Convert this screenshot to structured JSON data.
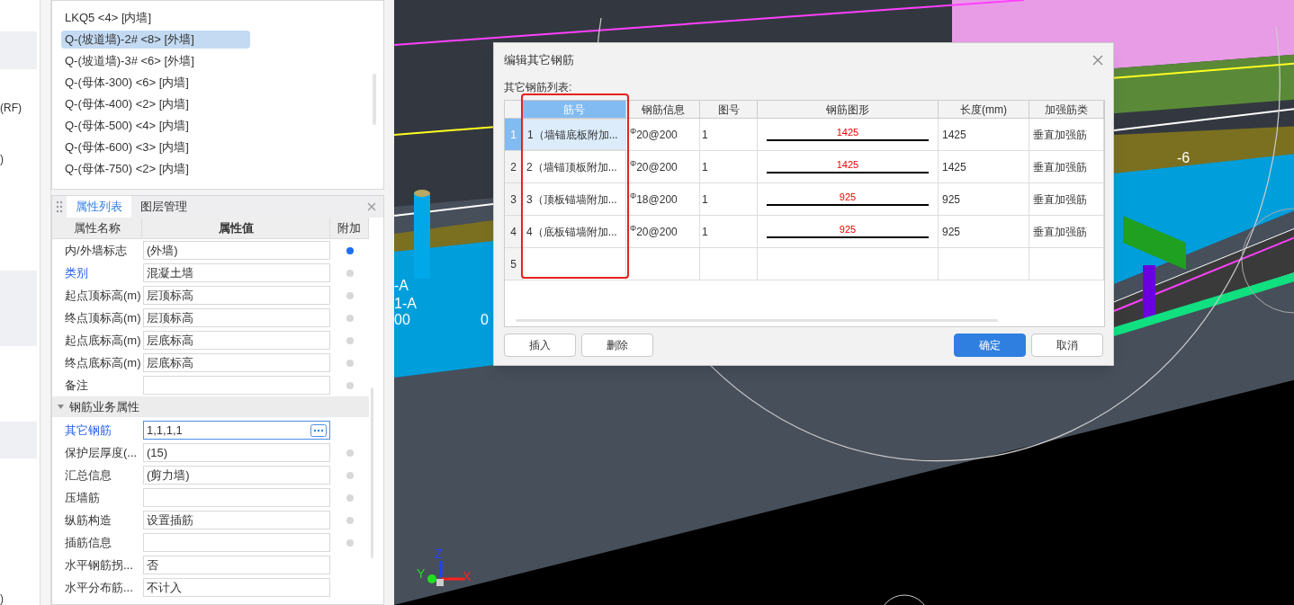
{
  "sidebar_fragments": [
    "(RF)",
    ")",
    ")"
  ],
  "component_list": {
    "items": [
      {
        "label": "LKQ5 <4> [内墙]",
        "selected": false
      },
      {
        "label": "Q-(坡道墙)-2# <8> [外墙]",
        "selected": true
      },
      {
        "label": "Q-(坡道墙)-3# <6> [外墙]",
        "selected": false
      },
      {
        "label": "Q-(母体-300) <6> [内墙]",
        "selected": false
      },
      {
        "label": "Q-(母体-400) <2> [内墙]",
        "selected": false
      },
      {
        "label": "Q-(母体-500) <4> [内墙]",
        "selected": false
      },
      {
        "label": "Q-(母体-600) <3> [内墙]",
        "selected": false
      },
      {
        "label": "Q-(母体-750) <2> [内墙]",
        "selected": false
      }
    ]
  },
  "properties_panel": {
    "tabs": [
      {
        "label": "属性列表",
        "selected": true
      },
      {
        "label": "图层管理",
        "selected": false
      }
    ],
    "columns": [
      "属性名称",
      "属性值",
      "附加"
    ],
    "rows": [
      {
        "kind": "row",
        "name": "内/外墙标志",
        "value": "(外墙)",
        "link": false,
        "attached": true
      },
      {
        "kind": "row",
        "name": "类别",
        "value": "混凝土墙",
        "link": true,
        "attached": false
      },
      {
        "kind": "row",
        "name": "起点顶标高(m)",
        "value": "层顶标高",
        "link": false,
        "attached": false
      },
      {
        "kind": "row",
        "name": "终点顶标高(m)",
        "value": "层顶标高",
        "link": false,
        "attached": false
      },
      {
        "kind": "row",
        "name": "起点底标高(m)",
        "value": "层底标高",
        "link": false,
        "attached": false
      },
      {
        "kind": "row",
        "name": "终点底标高(m)",
        "value": "层底标高",
        "link": false,
        "attached": false
      },
      {
        "kind": "row",
        "name": "备注",
        "value": "",
        "link": false,
        "attached": false
      },
      {
        "kind": "section",
        "name": "钢筋业务属性",
        "expanded": true
      },
      {
        "kind": "row",
        "name": "其它钢筋",
        "value": "1,1,1,1",
        "link": true,
        "editing": true
      },
      {
        "kind": "row",
        "name": "保护层厚度(...",
        "value": "(15)",
        "link": false,
        "attached": false
      },
      {
        "kind": "row",
        "name": "汇总信息",
        "value": "(剪力墙)",
        "link": false,
        "attached": false
      },
      {
        "kind": "row",
        "name": "压墙筋",
        "value": "",
        "link": false,
        "attached": false
      },
      {
        "kind": "row",
        "name": "纵筋构造",
        "value": "设置插筋",
        "link": false,
        "attached": false
      },
      {
        "kind": "row",
        "name": "插筋信息",
        "value": "",
        "link": false,
        "attached": false
      },
      {
        "kind": "row",
        "name": "水平钢筋拐...",
        "value": "否",
        "link": false
      },
      {
        "kind": "row",
        "name": "水平分布筋...",
        "value": "不计入",
        "link": false
      }
    ]
  },
  "viewport": {
    "labels": [
      "-A",
      "1-A",
      "00",
      "0",
      "-6"
    ],
    "axes": [
      "Z",
      "Y",
      "X"
    ]
  },
  "dialog": {
    "title": "编辑其它钢筋",
    "list_label": "其它钢筋列表:",
    "columns": [
      {
        "label": "筋号",
        "selected": true
      },
      {
        "label": "钢筋信息",
        "selected": false
      },
      {
        "label": "图号",
        "selected": false
      },
      {
        "label": "钢筋图形",
        "selected": false
      },
      {
        "label": "长度(mm)",
        "selected": false
      },
      {
        "label": "加强筋类",
        "selected": false
      }
    ],
    "rows": [
      {
        "num": "1",
        "bar_no": "1（墙锚底板附加...",
        "info": "$^{Φ}$20@200",
        "figure_no": "1",
        "shape_label": "1425",
        "length": "1425",
        "type": "垂直加强筋",
        "selected": true
      },
      {
        "num": "2",
        "bar_no": "2（墙锚顶板附加...",
        "info": "$^{Φ}$20@200",
        "figure_no": "1",
        "shape_label": "1425",
        "length": "1425",
        "type": "垂直加强筋",
        "selected": false
      },
      {
        "num": "3",
        "bar_no": "3（顶板锚墙附加...",
        "info": "$^{Φ}$18@200",
        "figure_no": "1",
        "shape_label": "925",
        "length": "925",
        "type": "垂直加强筋",
        "selected": false
      },
      {
        "num": "4",
        "bar_no": "4（底板锚墙附加...",
        "info": "$^{Φ}$20@200",
        "figure_no": "1",
        "shape_label": "925",
        "length": "925",
        "type": "垂直加强筋",
        "selected": false
      },
      {
        "num": "5",
        "selected": false
      }
    ],
    "left_buttons": [
      {
        "label": "插入",
        "kind": "default"
      },
      {
        "label": "删除",
        "kind": "default"
      }
    ],
    "right_buttons": [
      {
        "label": "确定",
        "kind": "primary"
      },
      {
        "label": "取消",
        "kind": "default"
      }
    ]
  }
}
